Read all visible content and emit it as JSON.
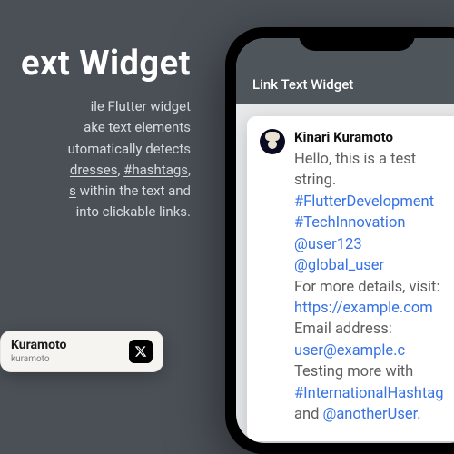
{
  "promo": {
    "title": "ext Widget",
    "desc_l1": "ile Flutter widget",
    "desc_l2": "ake text elements",
    "desc_l3_a": "utomatically detects",
    "desc_l4_a": "dresses",
    "desc_l4_b": "#hashtags",
    "desc_l5_a": "s",
    "desc_l5_b": " within the text and",
    "desc_l6": "into clickable links.",
    "sep": ", "
  },
  "author_card": {
    "name": "Kuramoto",
    "handle": "kuramoto"
  },
  "phone": {
    "appbar_title": "Link Text Widget"
  },
  "post": {
    "author": "Kinari Kuramoto",
    "plain1": "Hello, this is a test string. ",
    "link1": "#FlutterDevelopment",
    "link2": "#TechInnovation",
    "link3": "@user123",
    "link4": "@global_user",
    "plain2": "For more details, visit: ",
    "link5": "https://example.com",
    "plain3": "Email address: ",
    "link6": "user@example.c",
    "plain4": "Testing more with ",
    "link7": "#InternationalHashtag",
    "plain5": " and ",
    "link8": "@anotherUser",
    "plain6": "."
  }
}
